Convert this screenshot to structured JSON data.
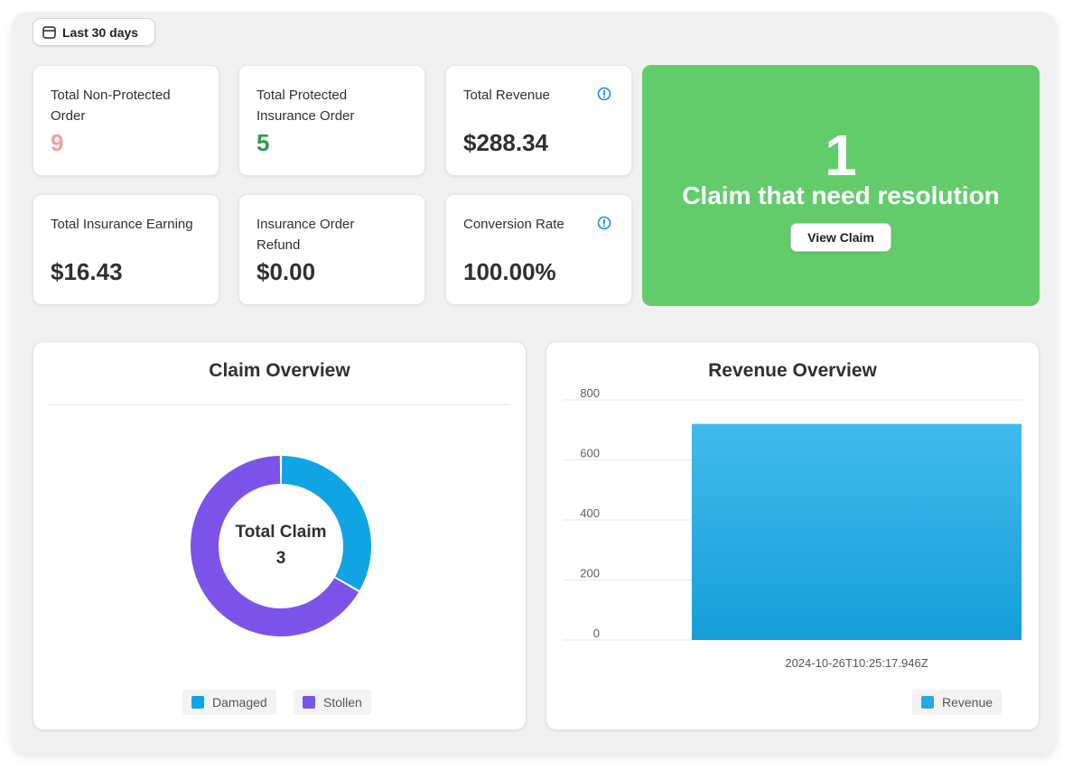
{
  "filter": {
    "label": "Last 30 days",
    "icon": "calendar-icon"
  },
  "stats": [
    {
      "label": "Total Non-Protected Order",
      "value": "9",
      "color": "#f4a19c",
      "info": false
    },
    {
      "label": "Total Protected Insurance Order",
      "value": "5",
      "color": "#22a048",
      "info": false
    },
    {
      "label": "Total Revenue",
      "value": "$288.34",
      "color": "#303030",
      "info": true
    },
    {
      "label": "Total Insurance Earning",
      "value": "$16.43",
      "color": "#303030",
      "info": false
    },
    {
      "label": "Insurance Order Refund",
      "value": "$0.00",
      "color": "#303030",
      "info": false
    },
    {
      "label": "Conversion Rate",
      "value": "100.00%",
      "color": "#303030",
      "info": true
    }
  ],
  "claim_banner": {
    "count": "1",
    "text": "Claim that need resolution",
    "button_label": "View Claim",
    "background": "#62cc6b"
  },
  "claim_overview": {
    "title": "Claim Overview",
    "center_label": "Total Claim",
    "center_value": "3",
    "legend": [
      {
        "name": "Damaged",
        "color": "#10a4e4"
      },
      {
        "name": "Stollen",
        "color": "#7b53e8"
      }
    ]
  },
  "revenue_overview": {
    "title": "Revenue Overview",
    "legend": [
      {
        "name": "Revenue",
        "color": "#28a8e2"
      }
    ]
  },
  "chart_data": [
    {
      "type": "pie",
      "title": "Claim Overview",
      "categories": [
        "Damaged",
        "Stollen"
      ],
      "values": [
        1,
        2
      ],
      "colors": [
        "#10a4e4",
        "#7b53e8"
      ],
      "center_text": "Total Claim 3",
      "legend": "bottom"
    },
    {
      "type": "bar",
      "title": "Revenue Overview",
      "categories": [
        "2024-10-26T10:25:17.946Z"
      ],
      "series": [
        {
          "name": "Revenue",
          "values": [
            720
          ]
        }
      ],
      "ylim": [
        0,
        800
      ],
      "yticks": [
        0,
        200,
        400,
        600,
        800
      ],
      "grid": true,
      "legend": "bottom-right",
      "colors": [
        "#40bbee",
        "#169ed8"
      ]
    }
  ]
}
